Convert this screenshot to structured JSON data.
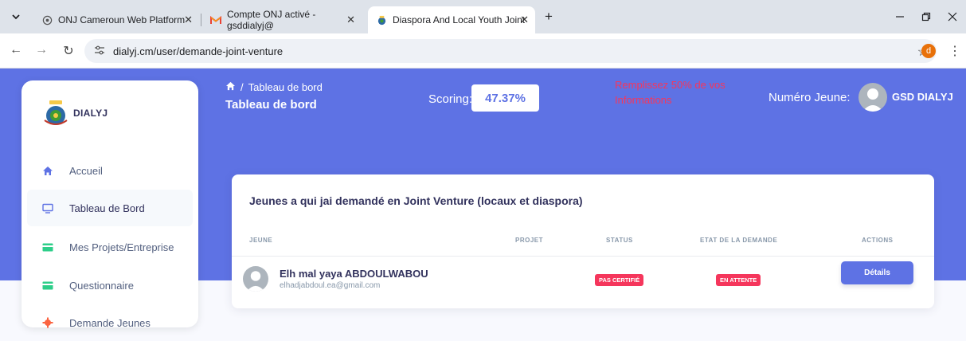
{
  "browser": {
    "tabs": [
      {
        "title": "ONJ Cameroun Web Platform",
        "icon": "globe-icon"
      },
      {
        "title": "Compte ONJ activé - gsddialyj@",
        "icon": "gmail-icon"
      },
      {
        "title": "Diaspora And Local Youth Joint",
        "icon": "dialyj-favicon-icon"
      }
    ],
    "new_tab": "+",
    "url": "dialyj.cm/user/demande-joint-venture",
    "profile_initial": "d"
  },
  "sidebar": {
    "brand": "DIALYJ",
    "items": [
      {
        "label": "Accueil",
        "icon": "home-icon",
        "color": "#5e72e4"
      },
      {
        "label": "Tableau de Bord",
        "icon": "monitor-icon",
        "color": "#5e72e4"
      },
      {
        "label": "Mes Projets/Entreprise",
        "icon": "card-icon",
        "color": "#2dce89"
      },
      {
        "label": "Questionnaire",
        "icon": "card-icon",
        "color": "#2dce89"
      },
      {
        "label": "Demande Jeunes",
        "icon": "settings-icon",
        "color": "#fb6340"
      }
    ]
  },
  "header": {
    "breadcrumb_sep": "/",
    "breadcrumb": "Tableau de bord",
    "title": "Tableau de bord",
    "scoring_label": "Scoring:",
    "scoring_value": "47.37%",
    "warning": "Remplissez 50% de vos Informations",
    "numero_label": "Numéro Jeune:",
    "user_name": "GSD DIALYJ"
  },
  "table": {
    "title": "Jeunes a qui jai demandé en Joint Venture (locaux et diaspora)",
    "columns": [
      "JEUNE",
      "PROJET",
      "STATUS",
      "ETAT DE LA DEMANDE",
      "ACTIONS"
    ],
    "rows": [
      {
        "name": "Elh mal yaya ABDOULWABOU",
        "email": "elhadjabdoul.ea@gmail.com",
        "projet": "",
        "status": "PAS CERTIFIÉ",
        "etat": "EN ATTENTE",
        "action": "Détails"
      }
    ]
  },
  "colors": {
    "primary": "#5e72e4",
    "danger": "#f5365c",
    "success": "#2dce89"
  }
}
